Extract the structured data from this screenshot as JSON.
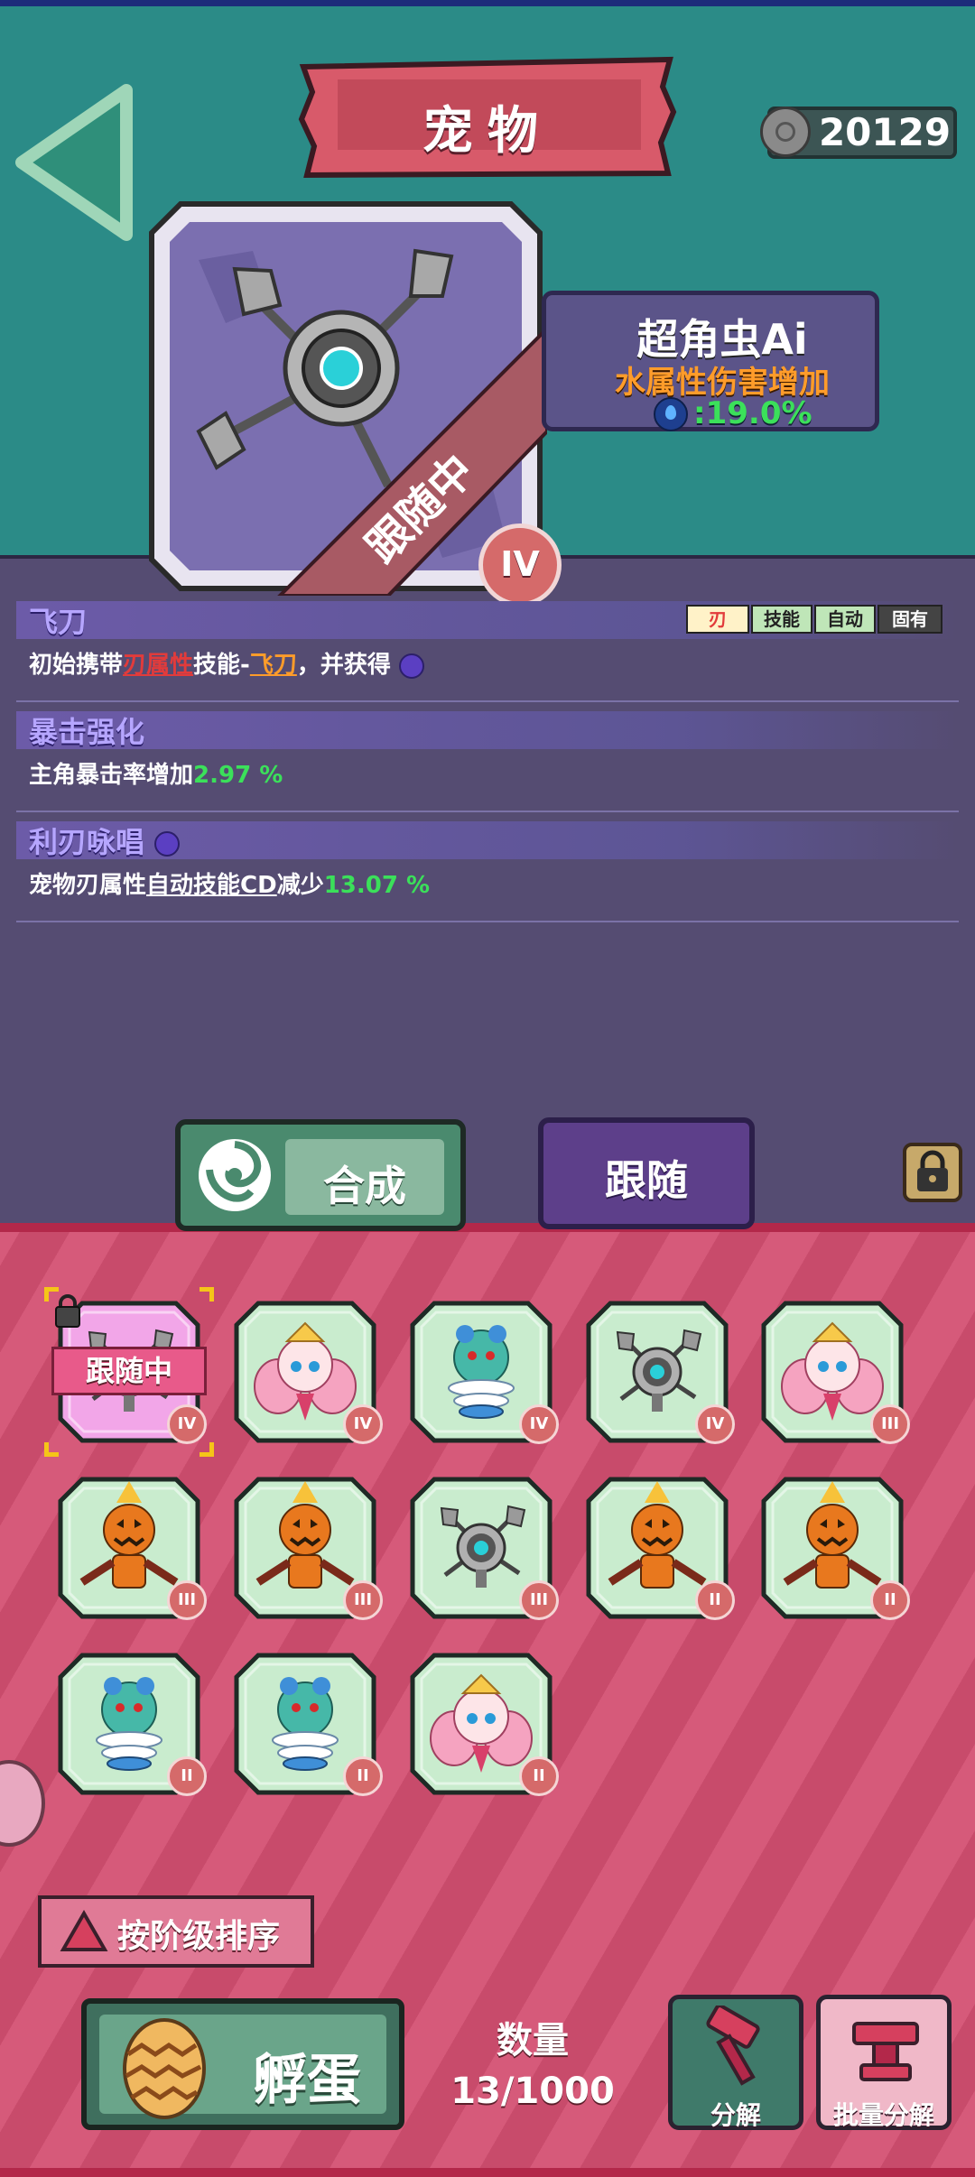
{
  "header": {
    "title": "宠物",
    "currency_amount": "20129"
  },
  "pet_card": {
    "name": "超角虫Ai",
    "attribute": "水属性伤害增加",
    "value": ":19.0%",
    "status_ribbon": "跟随中",
    "rank": "IV"
  },
  "skills": [
    {
      "title": "飞刀",
      "tags": [
        "刃",
        "技能",
        "自动",
        "固有"
      ],
      "desc_prefix": "初始携带",
      "desc_attr": "刃属性",
      "desc_mid": "技能-",
      "desc_skill": "飞刀",
      "desc_suffix": "，并获得"
    },
    {
      "title": "暴击强化",
      "desc_prefix": "主角暴击率增加",
      "desc_value": "2.97 %"
    },
    {
      "title": "利刃咏唱",
      "desc_prefix": "宠物刃属性",
      "desc_link": "自动技能CD",
      "desc_mid": "减少",
      "desc_value": "13.07 %"
    }
  ],
  "actions": {
    "synth_label": "合成",
    "follow_label": "跟随"
  },
  "pets": [
    {
      "type": "robot",
      "rank": "IV",
      "following": true,
      "follow_label": "跟随中",
      "locked": true
    },
    {
      "type": "fairy",
      "rank": "IV"
    },
    {
      "type": "spring",
      "rank": "IV"
    },
    {
      "type": "robot",
      "rank": "IV"
    },
    {
      "type": "fairy",
      "rank": "III"
    },
    {
      "type": "pumpkin",
      "rank": "III"
    },
    {
      "type": "pumpkin",
      "rank": "III"
    },
    {
      "type": "robot",
      "rank": "III"
    },
    {
      "type": "pumpkin",
      "rank": "II"
    },
    {
      "type": "pumpkin",
      "rank": "II"
    },
    {
      "type": "spring",
      "rank": "II"
    },
    {
      "type": "spring",
      "rank": "II"
    },
    {
      "type": "fairy",
      "rank": "II"
    }
  ],
  "footer": {
    "sort_label": "按阶级排序",
    "hatch_label": "孵蛋",
    "quantity_label": "数量",
    "quantity_value": "13/1000",
    "decompose_label": "分解",
    "batch_decompose_label": "批量分解"
  },
  "colors": {
    "top_bg": "#2b8b87",
    "panel_bg": "#554c72",
    "bottom_bg": "#d65a7a",
    "accent_green": "#3be05a",
    "accent_orange": "#ff9c2a"
  }
}
